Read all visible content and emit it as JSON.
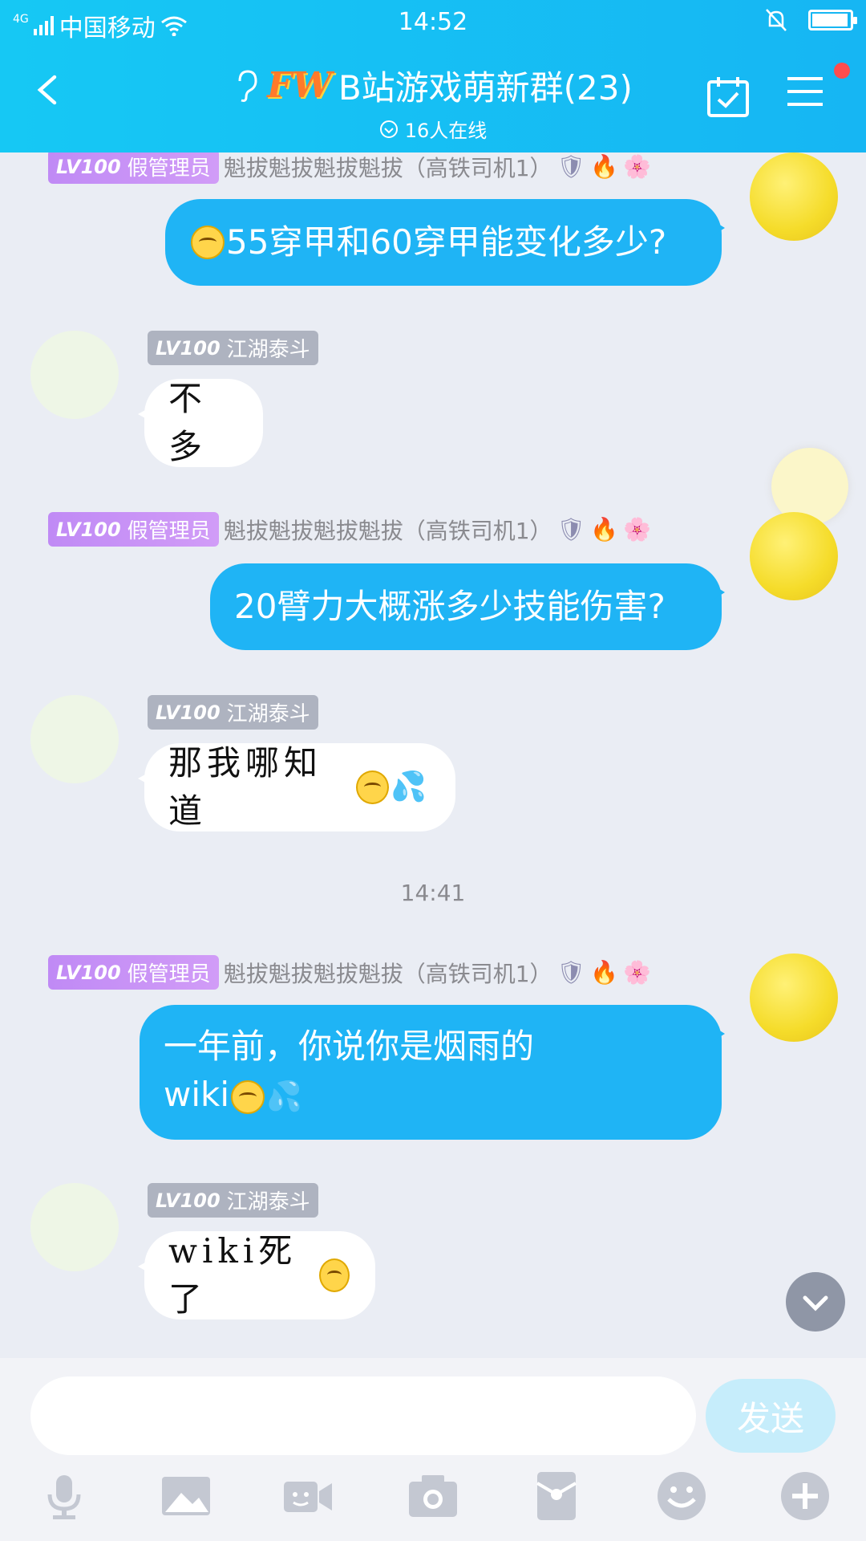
{
  "status": {
    "network": "4G",
    "carrier": "中国移动",
    "time": "14:52"
  },
  "header": {
    "title_logo": "FW",
    "title": "B站游戏萌新群(23)",
    "online": "16人在线"
  },
  "roles": {
    "admin_level": "LV100",
    "admin_title": "假管理员",
    "admin_name": "魁拔魁拔魁拔魁拔（高铁司机1）",
    "member_level": "LV100",
    "member_name": "江湖泰斗"
  },
  "messages": {
    "m1": "55穿甲和60穿甲能变化多少?",
    "m2": "不多",
    "m3": "20臂力大概涨多少技能伤害?",
    "m4": "那我哪知道",
    "time_divider": "14:41",
    "m5_line1": "一年前，你说你是烟雨的",
    "m5_line2": "wiki",
    "m6": "wiki死了"
  },
  "input": {
    "send_label": "发送",
    "placeholder": ""
  },
  "colors": {
    "header": "#16b6f3",
    "me_bubble": "#1fb4f5",
    "admin_tag": "#c08af5",
    "member_tag": "#aeb3c0"
  }
}
